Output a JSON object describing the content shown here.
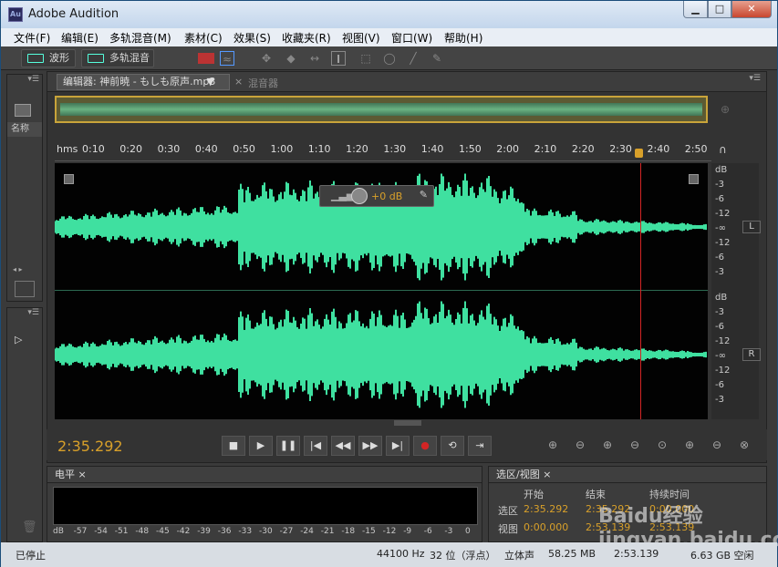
{
  "title": "Adobe Audition",
  "menus": [
    "文件(F)",
    "编辑(E)",
    "多轨混音(M)",
    "素材(C)",
    "效果(S)",
    "收藏夹(R)",
    "视图(V)",
    "窗口(W)",
    "帮助(H)"
  ],
  "toolbar": {
    "waveform_label": "波形",
    "multitrack_label": "多轨混音"
  },
  "left_panel": {
    "name_header": "名称"
  },
  "editor": {
    "tab_label": "编辑器: 神前暁 - もしも原声.mp3",
    "mixer_tab": "混音器"
  },
  "timeline_labels": [
    "hms",
    "0:10",
    "0:20",
    "0:30",
    "0:40",
    "0:50",
    "1:00",
    "1:10",
    "1:20",
    "1:30",
    "1:40",
    "1:50",
    "2:00",
    "2:10",
    "2:20",
    "2:30",
    "2:40",
    "2:50"
  ],
  "db_scale": [
    "dB",
    "-3",
    "-6",
    "-12",
    "-∞",
    "-12",
    "-6",
    "-3"
  ],
  "channels": {
    "left": "L",
    "right": "R"
  },
  "hud": {
    "value": "+0 dB"
  },
  "transport": {
    "current_time": "2:35.292"
  },
  "levels": {
    "title": "电平",
    "ticks": [
      "dB",
      "-57",
      "-54",
      "-51",
      "-48",
      "-45",
      "-42",
      "-39",
      "-36",
      "-33",
      "-30",
      "-27",
      "-24",
      "-21",
      "-18",
      "-15",
      "-12",
      "-9",
      "-6",
      "-3",
      "0"
    ]
  },
  "selview": {
    "title": "选区/视图",
    "col_start": "开始",
    "col_end": "结束",
    "col_duration": "持续时间",
    "row_selection": "选区",
    "row_view": "视图",
    "sel_start": "2:35.292",
    "sel_end": "2:35.292",
    "sel_duration": "0:00.000",
    "view_start": "0:00.000",
    "view_end": "2:53.139",
    "view_duration": "2:53.139"
  },
  "status": {
    "state": "已停止",
    "sample": "44100 Hz",
    "bits": "32 位（浮点）",
    "channels": "立体声",
    "size": "58.25 MB",
    "duration": "2:53.139",
    "free": "6.63 GB 空闲"
  },
  "watermark": "Baidu经验 jingyan.baidu.com",
  "colors": {
    "waveform": "#3fe0a0",
    "accent": "#d8a02a",
    "playhead": "#d42525"
  }
}
